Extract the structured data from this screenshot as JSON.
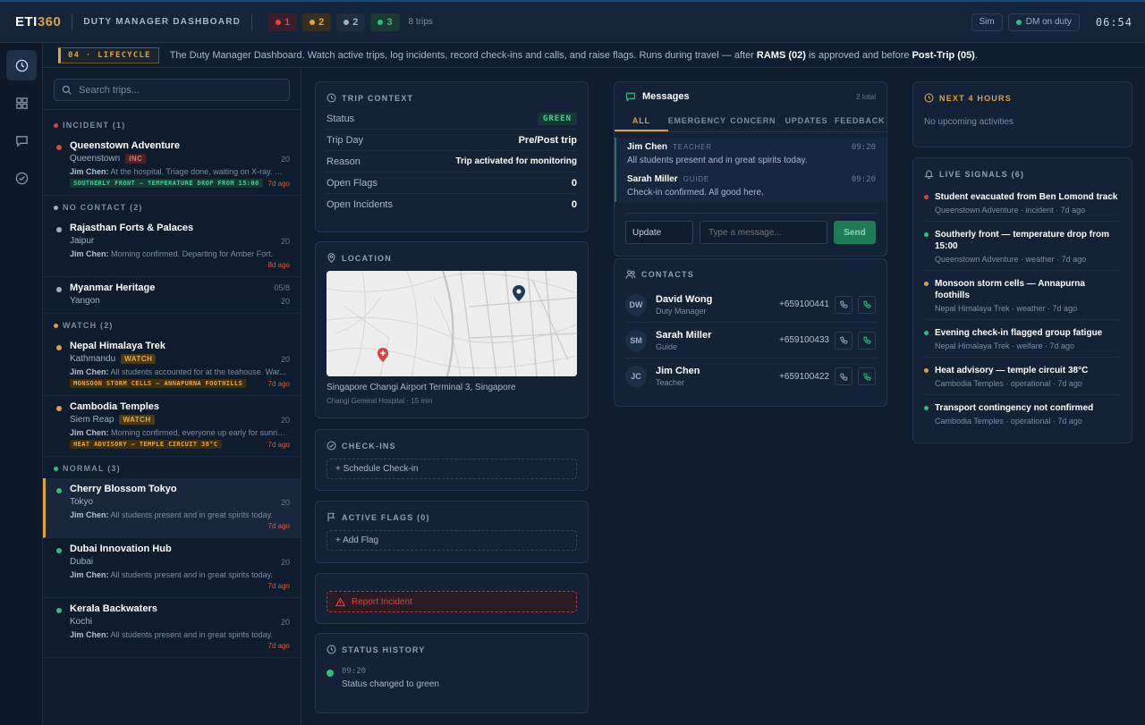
{
  "header": {
    "logo_main": "ETI",
    "logo_accent": "360",
    "title": "DUTY MANAGER DASHBOARD",
    "counts": [
      {
        "value": "1",
        "color": "#e0443a",
        "bg": "#3a1f2a"
      },
      {
        "value": "2",
        "color": "#e0a03a",
        "bg": "#3a2e1f"
      },
      {
        "value": "2",
        "color": "#9fb0c6",
        "bg": "#1f2d42"
      },
      {
        "value": "3",
        "color": "#2fbf7f",
        "bg": "#1a3a33"
      }
    ],
    "trips_count": "8 trips",
    "sim_label": "Sim",
    "duty_label": "DM on duty",
    "clock": "06:54"
  },
  "banner": {
    "badge": "04 · LIFECYCLE",
    "text_a": "The Duty Manager Dashboard. Watch active trips, log incidents, record check-ins and calls, and raise flags. Runs during travel — after ",
    "text_b": "RAMS (02)",
    "text_c": " is approved and before ",
    "text_d": "Post-Trip (05)",
    "text_e": "."
  },
  "search": {
    "placeholder": "Search trips..."
  },
  "groups": {
    "incident": "INCIDENT (1)",
    "nocontact": "NO CONTACT (2)",
    "watch": "WATCH (2)",
    "normal": "NORMAL (3)"
  },
  "trips": [
    {
      "name": "Queenstown Adventure",
      "city": "Queenstown",
      "tag": "INC",
      "date": "20",
      "who": "Jim Chen:",
      "msg": "At the hospital. Triage done, waiting on X-ray. Sh...",
      "signal": "SOUTHERLY FRONT — TEMPERATURE DROP FROM 15:00",
      "ago": "7d ago"
    },
    {
      "name": "Rajasthan Forts & Palaces",
      "city": "Jaipur",
      "date": "20",
      "who": "Jim Chen:",
      "msg": "Morning confirmed. Departing for Amber Fort.",
      "ago": "8d ago"
    },
    {
      "name": "Myanmar Heritage",
      "city": "Yangon",
      "date": "05/8",
      "date2": "20"
    },
    {
      "name": "Nepal Himalaya Trek",
      "city": "Kathmandu",
      "tag": "WATCH",
      "date": "20",
      "who": "Jim Chen:",
      "msg": "All students accounted for at the teahouse. War...",
      "signal": "MONSOON STORM CELLS — ANNAPURNA FOOTHILLS",
      "ago": "7d ago"
    },
    {
      "name": "Cambodia Temples",
      "city": "Siem Reap",
      "tag": "WATCH",
      "date": "20",
      "who": "Jim Chen:",
      "msg": "Morning confirmed, everyone up early for sunrise...",
      "signal": "HEAT ADVISORY — TEMPLE CIRCUIT 38°C",
      "ago": "7d ago"
    },
    {
      "name": "Cherry Blossom Tokyo",
      "city": "Tokyo",
      "date": "20",
      "who": "Jim Chen:",
      "msg": "All students present and in great spirits today.",
      "ago": "7d ago"
    },
    {
      "name": "Dubai Innovation Hub",
      "city": "Dubai",
      "date": "20",
      "who": "Jim Chen:",
      "msg": "All students present and in great spirits today.",
      "ago": "7d ago"
    },
    {
      "name": "Kerala Backwaters",
      "city": "Kochi",
      "date": "20",
      "who": "Jim Chen:",
      "msg": "All students present and in great spirits today.",
      "ago": "7d ago"
    }
  ],
  "context": {
    "title": "TRIP CONTEXT",
    "rows": [
      {
        "label": "Status",
        "value": "GREEN"
      },
      {
        "label": "Trip Day",
        "value": "Pre/Post trip"
      },
      {
        "label": "Reason",
        "value": "Trip activated for monitoring"
      },
      {
        "label": "Open Flags",
        "value": "0"
      },
      {
        "label": "Open Incidents",
        "value": "0"
      }
    ]
  },
  "location": {
    "title": "LOCATION",
    "place": "Singapore Changi Airport Terminal 3, Singapore",
    "hospital": "Changi General Hospital · 15 min"
  },
  "checkins": {
    "title": "CHECK-INS",
    "action": "+ Schedule Check-in"
  },
  "flags": {
    "title": "ACTIVE FLAGS (0)",
    "action": "+ Add Flag"
  },
  "incident": {
    "action": "Report Incident"
  },
  "history": {
    "title": "STATUS HISTORY",
    "time": "09:20",
    "text": "Status changed to green"
  },
  "messages": {
    "title": "Messages",
    "total": "2 total",
    "tabs": [
      "ALL",
      "EMERGENCY",
      "CONCERN",
      "UPDATES",
      "FEEDBACK"
    ],
    "items": [
      {
        "name": "Jim Chen",
        "role": "TEACHER",
        "time": "09:20",
        "text": "All students present and in great spirits today."
      },
      {
        "name": "Sarah Miller",
        "role": "GUIDE",
        "time": "09:20",
        "text": "Check-in confirmed. All good here."
      }
    ],
    "type_value": "Update",
    "placeholder": "Type a message...",
    "send": "Send"
  },
  "contacts": {
    "title": "CONTACTS",
    "items": [
      {
        "initials": "DW",
        "name": "David Wong",
        "role": "Duty Manager",
        "phone": "+659100441"
      },
      {
        "initials": "SM",
        "name": "Sarah Miller",
        "role": "Guide",
        "phone": "+659100433"
      },
      {
        "initials": "JC",
        "name": "Jim Chen",
        "role": "Teacher",
        "phone": "+659100422"
      }
    ]
  },
  "next": {
    "title": "NEXT 4 HOURS",
    "empty": "No upcoming activities"
  },
  "signals": {
    "title": "LIVE SIGNALS (6)",
    "items": [
      {
        "title": "Student evacuated from Ben Lomond track",
        "meta": "Queenstown Adventure · incident · 7d ago",
        "color": "#e0443a"
      },
      {
        "title": "Southerly front — temperature drop from 15:00",
        "meta": "Queenstown Adventure · weather · 7d ago",
        "color": "#2fbf7f"
      },
      {
        "title": "Monsoon storm cells — Annapurna foothills",
        "meta": "Nepal Himalaya Trek · weather · 7d ago",
        "color": "#e0a03a"
      },
      {
        "title": "Evening check-in flagged group fatigue",
        "meta": "Nepal Himalaya Trek · welfare · 7d ago",
        "color": "#2fbf7f"
      },
      {
        "title": "Heat advisory — temple circuit 38°C",
        "meta": "Cambodia Temples · operational · 7d ago",
        "color": "#e0a03a"
      },
      {
        "title": "Transport contingency not confirmed",
        "meta": "Cambodia Temples · operational · 7d ago",
        "color": "#2fbf7f"
      }
    ]
  }
}
